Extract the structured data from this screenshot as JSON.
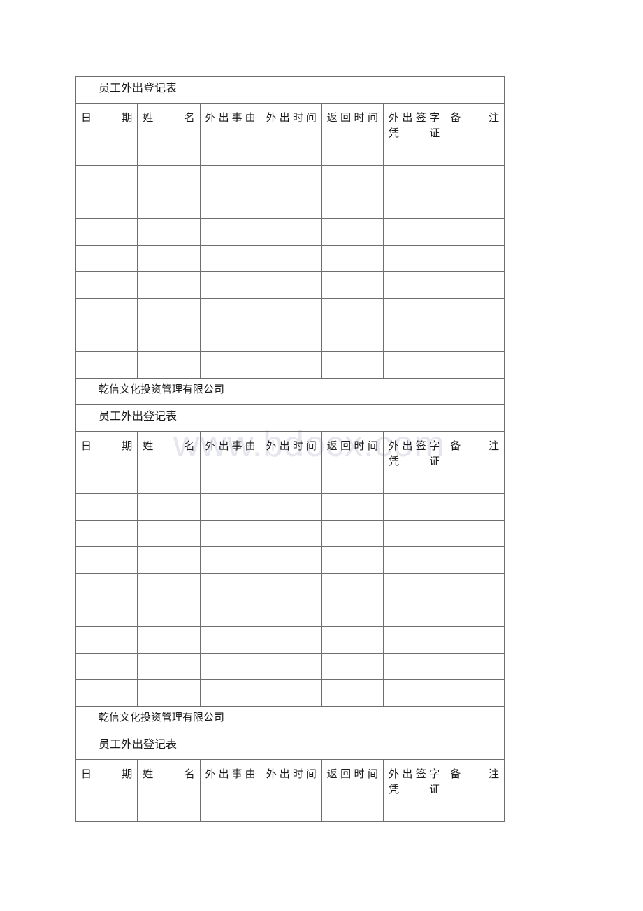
{
  "document": {
    "watermark": "www.bdocx.com",
    "company_name": "乾信文化投资管理有限公司",
    "form_title": "员工外出登记表",
    "columns": [
      "日期",
      "姓名",
      "外出事由",
      "外出时间",
      "返回时间",
      "外出签字凭证",
      "备注"
    ],
    "empty_rows_per_block": 8,
    "blocks": [
      {
        "has_company_row": false,
        "title": "员工外出登记表",
        "rows": 8,
        "truncated": false
      },
      {
        "has_company_row": true,
        "company": "乾信文化投资管理有限公司",
        "title": "员工外出登记表",
        "rows": 8,
        "truncated": false
      },
      {
        "has_company_row": true,
        "company": "乾信文化投资管理有限公司",
        "title": "员工外出登记表",
        "rows": 0,
        "truncated": true
      }
    ],
    "colors": {
      "text": "#1a1a1a",
      "border": "#6e6e6e",
      "watermark": "#e6e6ef",
      "background": "#ffffff"
    }
  }
}
